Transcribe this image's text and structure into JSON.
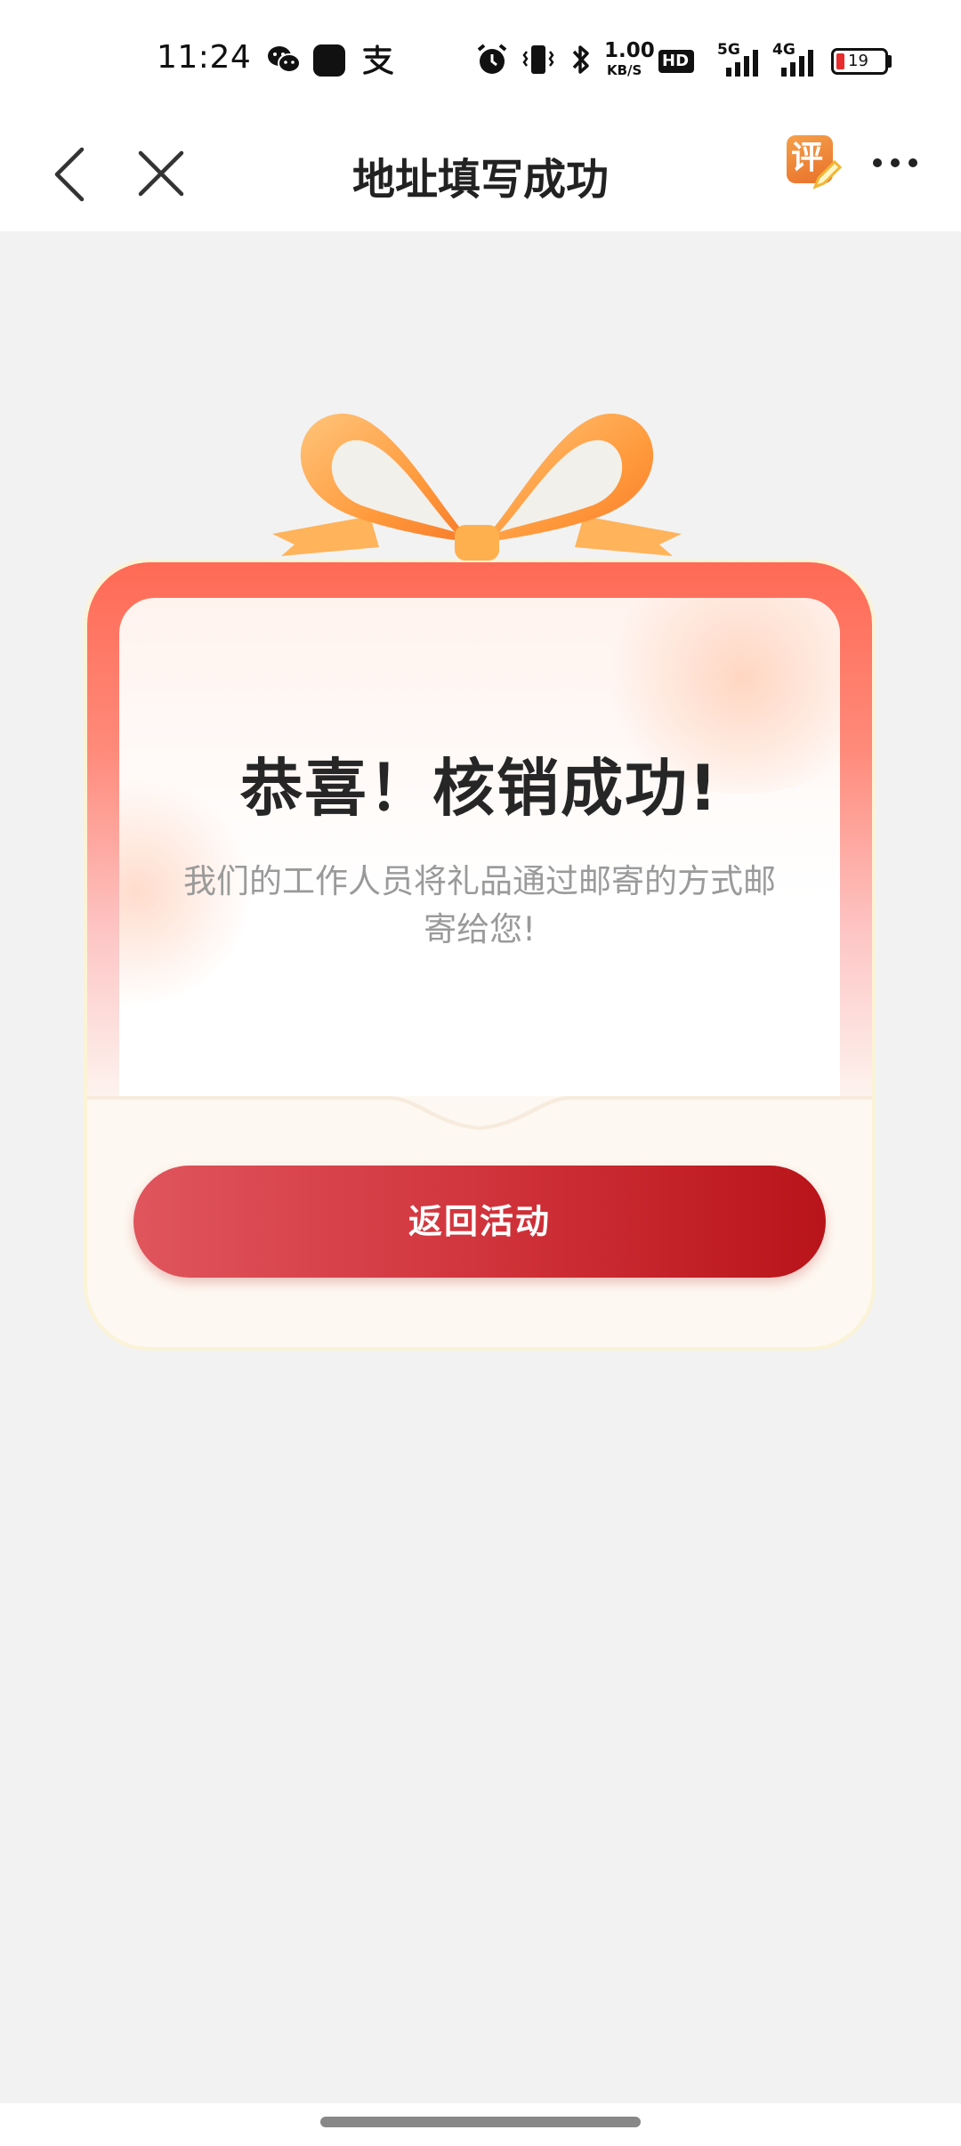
{
  "status_bar": {
    "time": "11:24",
    "net_speed_value": "1.00",
    "net_speed_unit": "KB/S",
    "hd_label": "HD",
    "signal_1_label": "5G",
    "signal_2_label": "4G",
    "battery_level": "19",
    "icons": [
      "wechat-icon",
      "app-icon",
      "alipay-icon",
      "alarm-icon",
      "vibrate-icon",
      "bluetooth-icon",
      "hd-icon",
      "signal-5g-icon",
      "signal-4g-icon",
      "battery-icon"
    ]
  },
  "nav": {
    "title": "地址填写成功",
    "review_badge": "评",
    "icons": [
      "back-icon",
      "close-icon",
      "review-icon",
      "more-icon"
    ]
  },
  "card": {
    "title": "恭喜！核销成功!",
    "message": "我们的工作人员将礼品通过邮寄的方式邮寄给您!",
    "button_label": "返回活动"
  },
  "colors": {
    "page_bg": "#f2f2f2",
    "card_top": "#ff6a55",
    "button_start": "#e0555d",
    "button_end": "#b8141a",
    "bow": "#f9a14a",
    "review_badge": "#f07d2c"
  }
}
